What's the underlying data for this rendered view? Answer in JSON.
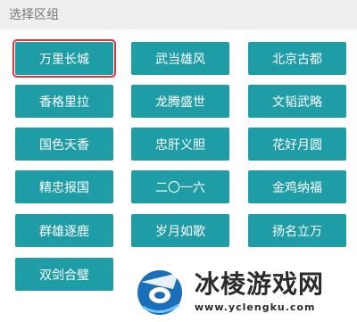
{
  "header": {
    "title": "选择区组"
  },
  "regions": [
    "万里长城",
    "武当雄风",
    "北京古都",
    "香格里拉",
    "龙腾盛世",
    "文韬武略",
    "国色天香",
    "忠肝义胆",
    "花好月圆",
    "精忠报国",
    "二〇一六",
    "金鸡纳福",
    "群雄逐鹿",
    "岁月如歌",
    "扬名立万",
    "双剑合璧"
  ],
  "selected_region": "万里长城",
  "colors": {
    "button_bg": "#1f9da6",
    "selected_outline": "#e2333a",
    "header_bg": "#efefef"
  },
  "watermark": {
    "name": "冰棱游戏网",
    "url": "www.yclengku.com"
  }
}
